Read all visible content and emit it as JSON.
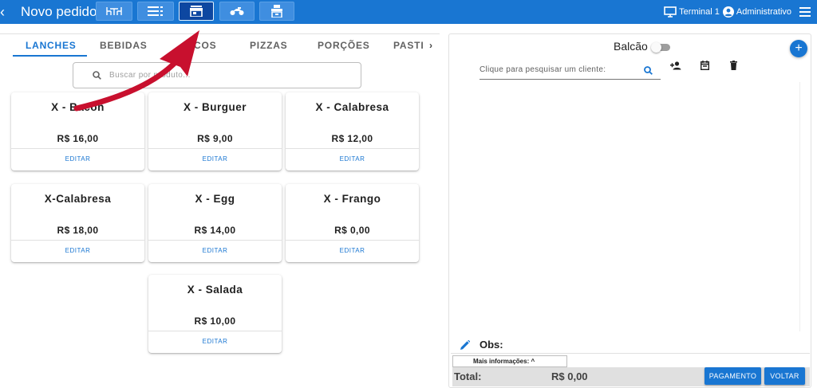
{
  "header": {
    "back_glyph": "‹",
    "title": "Novo pedido",
    "toolbar_buttons": [
      "tables-icon",
      "list-icon",
      "store-icon",
      "motorcycle-icon",
      "counter-icon"
    ],
    "active_button": "store-icon",
    "terminal_label": "Terminal 1",
    "user_label": "Administrativo"
  },
  "tabs": {
    "items": [
      "LANCHES",
      "BEBIDAS",
      "DOCES",
      "PIZZAS",
      "PORÇÕES",
      "PASTI"
    ],
    "visible_labels": [
      "LANCHES",
      "BEBIDAS",
      "COS",
      "PIZZAS",
      "PORÇÕES",
      "PASTI"
    ],
    "active": "LANCHES",
    "next_glyph": "›"
  },
  "search": {
    "placeholder": "Buscar por produto..."
  },
  "products": [
    {
      "name": "X - Bacon",
      "price": "R$ 16,00",
      "action": "EDITAR"
    },
    {
      "name": "X - Burguer",
      "price": "R$ 9,00",
      "action": "EDITAR"
    },
    {
      "name": "X - Calabresa",
      "price": "R$ 12,00",
      "action": "EDITAR"
    },
    {
      "name": "X-Calabresa",
      "price": "R$ 18,00",
      "action": "EDITAR"
    },
    {
      "name": "X - Egg",
      "price": "R$ 14,00",
      "action": "EDITAR"
    },
    {
      "name": "X - Frango",
      "price": "R$ 0,00",
      "action": "EDITAR"
    },
    {
      "name": "X - Salada",
      "price": "R$ 10,00",
      "action": "EDITAR"
    }
  ],
  "order": {
    "mode_label": "Balcão",
    "mode_toggle_on": false,
    "add_glyph": "+",
    "client_placeholder": "Clique para pesquisar um cliente:",
    "obs_label": "Obs:",
    "more_info_label": "Mais informações: ^",
    "total_label": "Total:",
    "total_value": "R$ 0,00",
    "pay_button": "PAGAMENTO",
    "back_button": "VOLTAR"
  },
  "colors": {
    "primary": "#1976d2",
    "annotation_arrow": "#c8102e"
  }
}
